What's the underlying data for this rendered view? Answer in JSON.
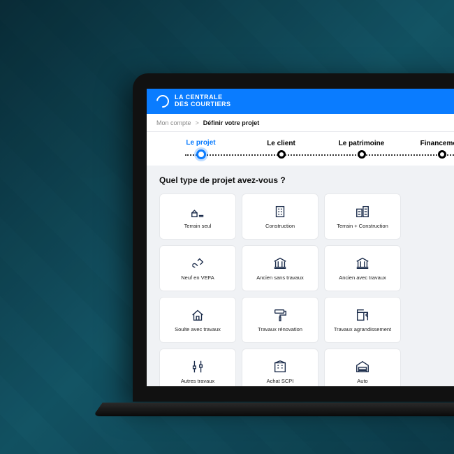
{
  "brand": {
    "line1": "LA CENTRALE",
    "line2": "DES COURTIERS"
  },
  "breadcrumb": {
    "parent": "Mon compte",
    "sep": ">",
    "current": "Définir votre projet"
  },
  "steps": [
    {
      "label": "Le projet",
      "active": true
    },
    {
      "label": "Le client",
      "active": false
    },
    {
      "label": "Le patrimoine",
      "active": false
    },
    {
      "label": "Financement",
      "active": false
    }
  ],
  "question": "Quel type de projet avez-vous ?",
  "cards": [
    {
      "label": "Terrain seul",
      "icon": "plot"
    },
    {
      "label": "Construction",
      "icon": "building"
    },
    {
      "label": "Terrain + Construction",
      "icon": "building2"
    },
    {
      "label": "",
      "icon": ""
    },
    {
      "label": "Neuf en VEFA",
      "icon": "hands"
    },
    {
      "label": "Ancien sans travaux",
      "icon": "bank"
    },
    {
      "label": "Ancien avec travaux",
      "icon": "bank"
    },
    {
      "label": "",
      "icon": ""
    },
    {
      "label": "Soulte avec travaux",
      "icon": "house"
    },
    {
      "label": "Travaux rénovation",
      "icon": "roller"
    },
    {
      "label": "Travaux agrandissement",
      "icon": "expand"
    },
    {
      "label": "",
      "icon": ""
    },
    {
      "label": "Autres travaux",
      "icon": "tools"
    },
    {
      "label": "Achat SCPI",
      "icon": "office"
    },
    {
      "label": "Auto",
      "icon": "garage"
    },
    {
      "label": "",
      "icon": ""
    }
  ]
}
